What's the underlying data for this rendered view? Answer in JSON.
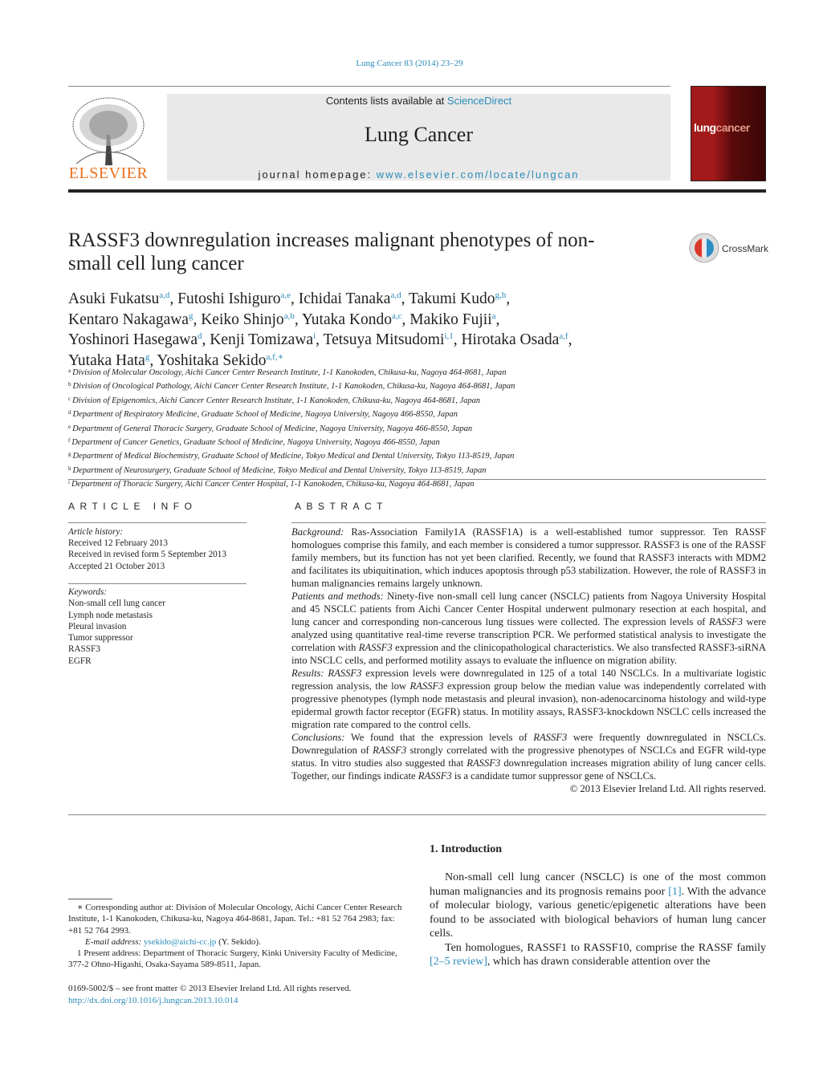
{
  "header": {
    "citation": "Lung Cancer 83 (2014) 23–29",
    "contents_prefix": "Contents lists available at ",
    "contents_link": "ScienceDirect",
    "journal_title": "Lung Cancer",
    "homepage_prefix": "journal homepage: ",
    "homepage_link": "www.elsevier.com/locate/lungcan",
    "publisher_logo": "ELSEVIER",
    "cover_title_a": "lung",
    "cover_title_b": "cancer",
    "crossmark": "CrossMark"
  },
  "article": {
    "title": "RASSF3 downregulation increases malignant phenotypes of non-small cell lung cancer",
    "authors": [
      {
        "name": "Asuki Fukatsu",
        "sup": "a,d"
      },
      {
        "name": "Futoshi Ishiguro",
        "sup": "a,e"
      },
      {
        "name": "Ichidai Tanaka",
        "sup": "a,d"
      },
      {
        "name": "Takumi Kudo",
        "sup": "g,h"
      },
      {
        "name": "Kentaro Nakagawa",
        "sup": "g"
      },
      {
        "name": "Keiko Shinjo",
        "sup": "a,b"
      },
      {
        "name": "Yutaka Kondo",
        "sup": "a,c"
      },
      {
        "name": "Makiko Fujii",
        "sup": "a"
      },
      {
        "name": "Yoshinori Hasegawa",
        "sup": "d"
      },
      {
        "name": "Kenji Tomizawa",
        "sup": "i"
      },
      {
        "name": "Tetsuya Mitsudomi",
        "sup": "i,1"
      },
      {
        "name": "Hirotaka Osada",
        "sup": "a,f"
      },
      {
        "name": "Yutaka Hata",
        "sup": "g"
      },
      {
        "name": "Yoshitaka Sekido",
        "sup": "a,f,∗"
      }
    ],
    "affiliations": [
      {
        "key": "a",
        "text": "Division of Molecular Oncology, Aichi Cancer Center Research Institute, 1-1 Kanokoden, Chikusa-ku, Nagoya 464-8681, Japan"
      },
      {
        "key": "b",
        "text": "Division of Oncological Pathology, Aichi Cancer Center Research Institute, 1-1 Kanokoden, Chikusa-ku, Nagoya 464-8681, Japan"
      },
      {
        "key": "c",
        "text": "Division of Epigenomics, Aichi Cancer Center Research Institute, 1-1 Kanokoden, Chikusa-ku, Nagoya 464-8681, Japan"
      },
      {
        "key": "d",
        "text": "Department of Respiratory Medicine, Graduate School of Medicine, Nagoya University, Nagoya 466-8550, Japan"
      },
      {
        "key": "e",
        "text": "Department of General Thoracic Surgery, Graduate School of Medicine, Nagoya University, Nagoya 466-8550, Japan"
      },
      {
        "key": "f",
        "text": "Department of Cancer Genetics, Graduate School of Medicine, Nagoya University, Nagoya 466-8550, Japan"
      },
      {
        "key": "g",
        "text": "Department of Medical Biochemistry, Graduate School of Medicine, Tokyo Medical and Dental University, Tokyo 113-8519, Japan"
      },
      {
        "key": "h",
        "text": "Department of Neurosurgery, Graduate School of Medicine, Tokyo Medical and Dental University, Tokyo 113-8519, Japan"
      },
      {
        "key": "i",
        "text": "Department of Thoracic Surgery, Aichi Cancer Center Hospital, 1-1 Kanokoden, Chikusa-ku, Nagoya 464-8681, Japan"
      }
    ]
  },
  "article_info": {
    "heading": "ARTICLE INFO",
    "history_label": "Article history:",
    "history": [
      "Received 12 February 2013",
      "Received in revised form 5 September 2013",
      "Accepted 21 October 2013"
    ],
    "keywords_label": "Keywords:",
    "keywords": [
      "Non-small cell lung cancer",
      "Lymph node metastasis",
      "Pleural invasion",
      "Tumor suppressor",
      "RASSF3",
      "EGFR"
    ]
  },
  "abstract": {
    "heading": "ABSTRACT",
    "paragraphs": [
      [
        {
          "t": "Background:",
          "s": "lbl"
        },
        {
          "t": " Ras-Association Family1A (RASSF1A) is a well-established tumor suppressor. Ten RASSF homologues comprise this family, and each member is considered a tumor suppressor. RASSF3 is one of the RASSF family members, but its function has not yet been clarified. Recently, we found that RASSF3 interacts with MDM2 and facilitates its ubiquitination, which induces apoptosis through p53 stabilization. However, the role of RASSF3 in human malignancies remains largely unknown."
        }
      ],
      [
        {
          "t": "Patients and methods:",
          "s": "lbl"
        },
        {
          "t": " Ninety-five non-small cell lung cancer (NSCLC) patients from Nagoya University Hospital and 45 NSCLC patients from Aichi Cancer Center Hospital underwent pulmonary resection at each hospital, and lung cancer and corresponding non-cancerous lung tissues were collected. The expression levels of "
        },
        {
          "t": "RASSF3",
          "s": "it"
        },
        {
          "t": " were analyzed using quantitative real-time reverse transcription PCR. We performed statistical analysis to investigate the correlation with "
        },
        {
          "t": "RASSF3",
          "s": "it"
        },
        {
          "t": " expression and the clinicopathological characteristics. We also transfected RASSF3-siRNA into NSCLC cells, and performed motility assays to evaluate the influence on migration ability."
        }
      ],
      [
        {
          "t": "Results:",
          "s": "lbl"
        },
        {
          "t": " "
        },
        {
          "t": "RASSF3",
          "s": "it"
        },
        {
          "t": " expression levels were downregulated in 125 of a total 140 NSCLCs. In a multivariate logistic regression analysis, the low "
        },
        {
          "t": "RASSF3",
          "s": "it"
        },
        {
          "t": " expression group below the median value was independently correlated with progressive phenotypes (lymph node metastasis and pleural invasion), non-adenocarcinoma histology and wild-type epidermal growth factor receptor (EGFR) status. In motility assays, RASSF3-knockdown NSCLC cells increased the migration rate compared to the control cells."
        }
      ],
      [
        {
          "t": "Conclusions:",
          "s": "lbl"
        },
        {
          "t": " We found that the expression levels of "
        },
        {
          "t": "RASSF3",
          "s": "it"
        },
        {
          "t": " were frequently downregulated in NSCLCs. Downregulation of "
        },
        {
          "t": "RASSF3",
          "s": "it"
        },
        {
          "t": " strongly correlated with the progressive phenotypes of NSCLCs and EGFR wild-type status. In vitro studies also suggested that "
        },
        {
          "t": "RASSF3",
          "s": "it"
        },
        {
          "t": " downregulation increases migration ability of lung cancer cells. Together, our findings indicate "
        },
        {
          "t": "RASSF3",
          "s": "it"
        },
        {
          "t": " is a candidate tumor suppressor gene of NSCLCs."
        }
      ]
    ],
    "copyright": "© 2013 Elsevier Ireland Ltd. All rights reserved."
  },
  "introduction": {
    "heading": "1.  Introduction",
    "paragraphs": [
      [
        {
          "t": "Non-small cell lung cancer (NSCLC) is one of the most common human malignancies and its prognosis remains poor "
        },
        {
          "t": "[1]",
          "s": "ref"
        },
        {
          "t": ". With the advance of molecular biology, various genetic/epigenetic alterations have been found to be associated with biological behaviors of human lung cancer cells."
        }
      ],
      [
        {
          "t": "Ten homologues, RASSF1 to RASSF10, comprise the RASSF family "
        },
        {
          "t": "[2–5 review]",
          "s": "ref"
        },
        {
          "t": ", which has drawn considerable attention over the"
        }
      ]
    ]
  },
  "footnotes": {
    "corresponding": "∗  Corresponding author at: Division of Molecular Oncology, Aichi Cancer Center Research Institute, 1-1 Kanokoden, Chikusa-ku, Nagoya 464-8681, Japan. Tel.: +81 52 764 2983; fax: +81 52 764 2993.",
    "email_label": "E-mail address:",
    "email": "ysekido@aichi-cc.jp",
    "email_suffix": " (Y. Sekido).",
    "present_address": "1  Present address: Department of Thoracic Surgery, Kinki University Faculty of Medicine, 377-2 Ohno-Higashi, Osaka-Sayama 589-8511, Japan.",
    "issn": "0169-5002/$ – see front matter © 2013 Elsevier Ireland Ltd. All rights reserved.",
    "doi": "http://dx.doi.org/10.1016/j.lungcan.2013.10.014"
  },
  "colors": {
    "link": "#2a8ab8",
    "elsevier_orange": "#e9711c",
    "cover_red": "#a31a1a"
  }
}
